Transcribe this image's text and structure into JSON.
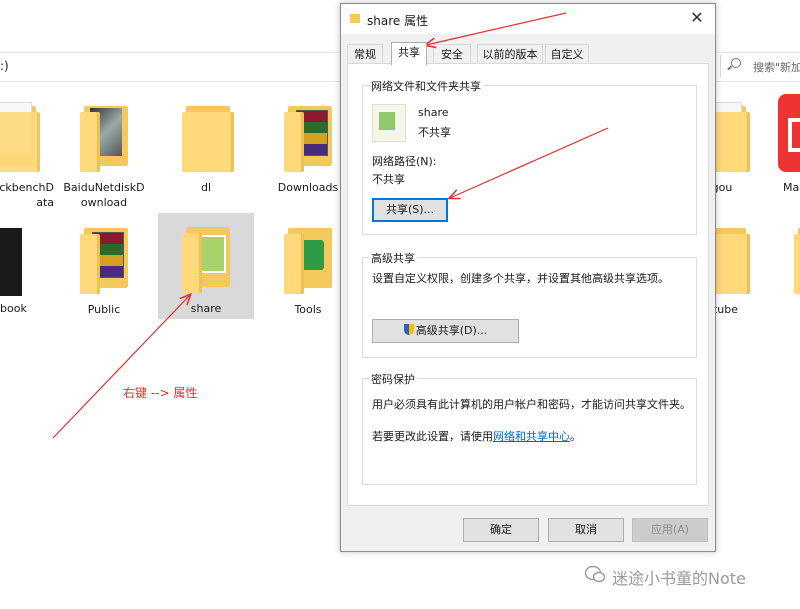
{
  "explorer": {
    "address_text": ":)",
    "search_placeholder": "搜索\"新加",
    "items": [
      {
        "label": "ckbenchD\nata"
      },
      {
        "label": "BaiduNetdiskD\nownload"
      },
      {
        "label": "dl"
      },
      {
        "label": "Downloads"
      },
      {
        "label": "gou"
      },
      {
        "label": "Ma"
      },
      {
        "label": "book"
      },
      {
        "label": "Public"
      },
      {
        "label": "share"
      },
      {
        "label": "Tools"
      },
      {
        "label": "utube"
      }
    ]
  },
  "annotation": {
    "text": "右键 --> 属性",
    "color": "#e03030"
  },
  "dialog": {
    "title": "share 属性",
    "tabs": [
      "常规",
      "共享",
      "安全",
      "以前的版本",
      "自定义"
    ],
    "active_tab": "共享",
    "network_sharing": {
      "group_title": "网络文件和文件夹共享",
      "folder_name": "share",
      "status": "不共享",
      "path_label": "网络路径(N):",
      "path_value": "不共享",
      "share_button": "共享(S)..."
    },
    "advanced_sharing": {
      "group_title": "高级共享",
      "description": "设置自定义权限，创建多个共享，并设置其他高级共享选项。",
      "button": "高级共享(D)..."
    },
    "password_protection": {
      "group_title": "密码保护",
      "description": "用户必须具有此计算机的用户帐户和密码，才能访问共享文件夹。",
      "change_prefix": "若要更改此设置，请使用",
      "change_link": "网络和共享中心",
      "change_suffix": "。"
    },
    "buttons": {
      "ok": "确定",
      "cancel": "取消",
      "apply": "应用(A)"
    }
  },
  "watermark": {
    "text": "迷途小书童的Note"
  }
}
